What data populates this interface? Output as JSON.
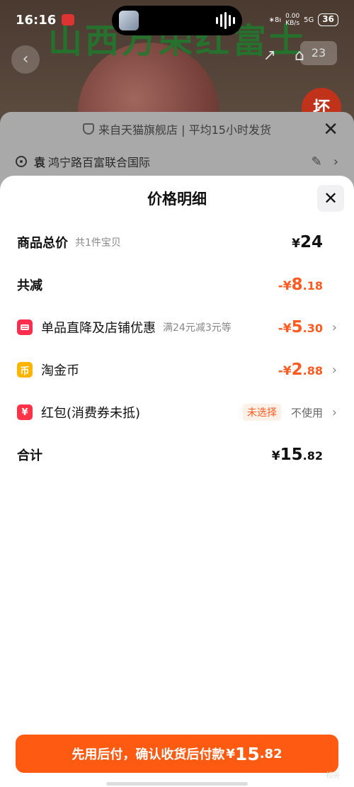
{
  "status_bar": {
    "time": "16:16",
    "net_speed": "0.00",
    "net_unit": "KB/s",
    "signal": "5G",
    "battery": "36"
  },
  "background": {
    "banner": "山西万荣红富士",
    "badge": "23",
    "red_circle": "坏",
    "shop_info": "来自天猫旗舰店 | 平均15小时发货",
    "address_name": "袁",
    "address": "鸿宁路百富联合国际"
  },
  "sheet": {
    "title": "价格明细",
    "rows": {
      "total": {
        "label": "商品总价",
        "sub": "共1件宝贝",
        "cur": "¥",
        "int": "24",
        "dec": ""
      },
      "reduce": {
        "label": "共减",
        "cur": "-¥",
        "int": "8",
        "dec": ".18"
      },
      "discount": {
        "label": "单品直降及店铺优惠",
        "sub": "满24元减3元等",
        "cur": "-¥",
        "int": "5",
        "dec": ".30"
      },
      "coins": {
        "label": "淘金币",
        "icon_text": "币",
        "cur": "-¥",
        "int": "2",
        "dec": ".88"
      },
      "redpacket": {
        "label": "红包(消费券未抵)",
        "icon_text": "¥",
        "tag": "未选择",
        "status": "不使用"
      },
      "sum": {
        "label": "合计",
        "cur": "¥",
        "int": "15",
        "dec": ".82"
      }
    }
  },
  "pay_button": {
    "label": "先用后付，确认收货后付款",
    "cur": "¥",
    "int": "15",
    "dec": ".82"
  },
  "corner_mark": "相关",
  "colors": {
    "accent": "#ff5a1f",
    "button": "#ff5a12"
  }
}
